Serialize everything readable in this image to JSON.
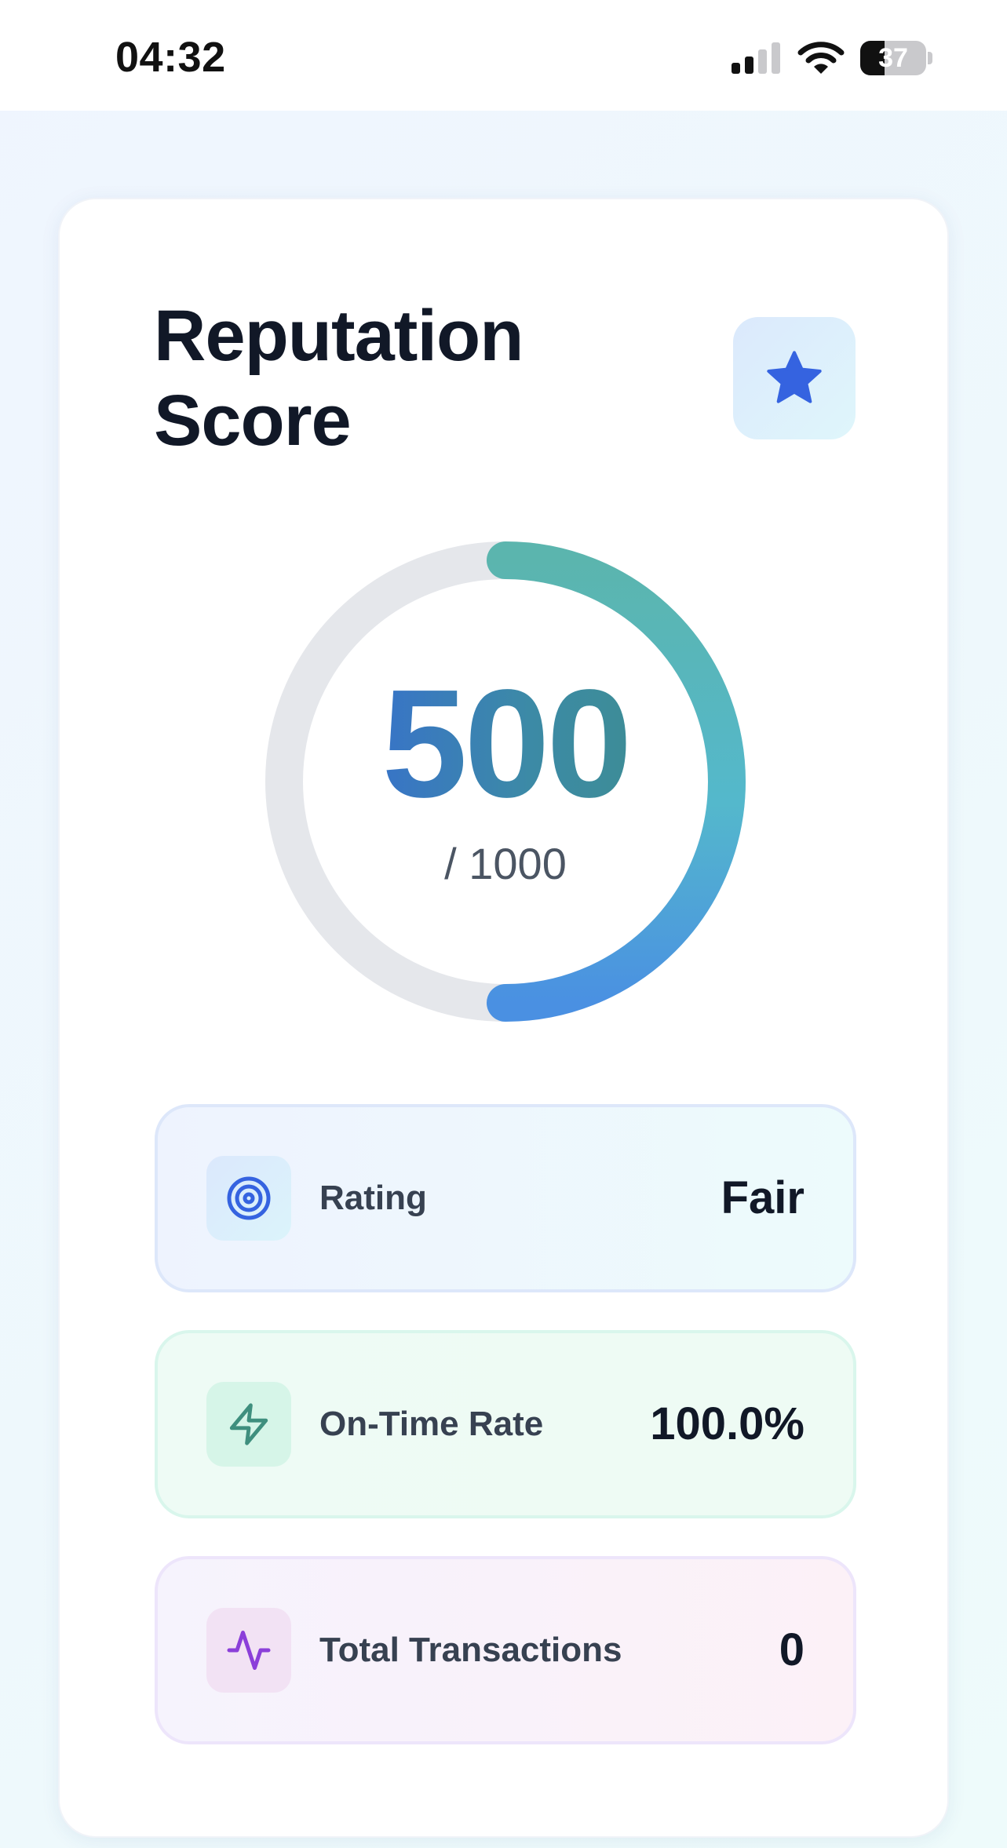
{
  "status_bar": {
    "time": "04:32",
    "battery_level": "37",
    "battery_fraction": 0.37
  },
  "header": {
    "title": "Reputation Score",
    "badge_icon": "star-icon"
  },
  "score": {
    "value": "500",
    "max_label": "/ 1000",
    "fraction": 0.5
  },
  "colors": {
    "primary": "#3563e0",
    "gauge_start": "#4a90e2",
    "gauge_mid": "#54b8cc",
    "gauge_end": "#5bb5ae",
    "gauge_track": "#e5e7eb",
    "title": "#111827"
  },
  "stats": [
    {
      "label": "Rating",
      "value": "Fair",
      "icon": "target-icon",
      "icon_color": "#3563e0"
    },
    {
      "label": "On-Time Rate",
      "value": "100.0%",
      "icon": "lightning-icon",
      "icon_color": "#3f8f7e"
    },
    {
      "label": "Total Transactions",
      "value": "0",
      "icon": "activity-icon",
      "icon_color": "#8b3fd9"
    }
  ]
}
